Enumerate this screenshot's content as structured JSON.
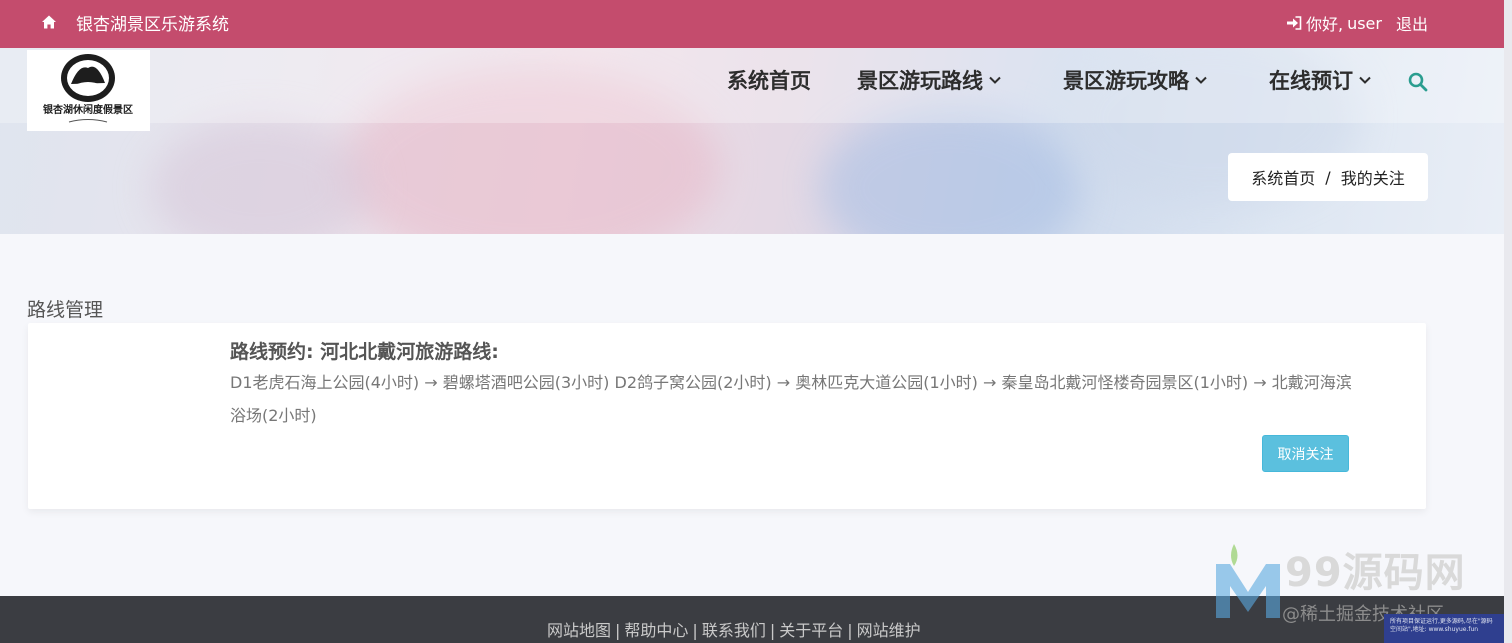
{
  "topbar": {
    "site_title": "银杏湖景区乐游系统",
    "greeting": "你好,",
    "username": "user",
    "logout_label": "退出",
    "bg_color": "#c44c6d"
  },
  "logo": {
    "text": "银杏湖休闲度假景区"
  },
  "nav": {
    "items": [
      {
        "label": "系统首页"
      },
      {
        "label": "景区游玩路线"
      },
      {
        "label": "景区游玩攻略"
      },
      {
        "label": "在线预订"
      }
    ]
  },
  "breadcrumb": {
    "home": "系统首页",
    "separator": "/",
    "current": "我的关注"
  },
  "main": {
    "section_title": "路线管理",
    "route": {
      "title": "路线预约: 河北北戴河旅游路线:",
      "description": "D1老虎石海上公园(4小时) → 碧螺塔酒吧公园(3小时) D2鸽子窝公园(2小时) → 奥林匹克大道公园(1小时) → 秦皇岛北戴河怪楼奇园景区(1小时) → 北戴河海滨浴场(2小时)",
      "unfollow_label": "取消关注"
    }
  },
  "footer": {
    "links": [
      "网站地图",
      "帮助中心",
      "联系我们",
      "关于平台",
      "网站维护"
    ],
    "separator": "|"
  },
  "watermark": {
    "brand": "99源码网",
    "sub": "@稀土掘金技术社区",
    "box_text": "所有项目保证运行,更多源码,尽在\"源码空间站\",地址: www.shuyue.fun"
  },
  "icons": {
    "home": "home-icon",
    "login": "sign-in-icon",
    "search": "search-icon",
    "chevron": "chevron-down-icon"
  },
  "colors": {
    "accent": "#c44c6d",
    "button": "#5bc0de",
    "footer": "#3b3d42"
  }
}
